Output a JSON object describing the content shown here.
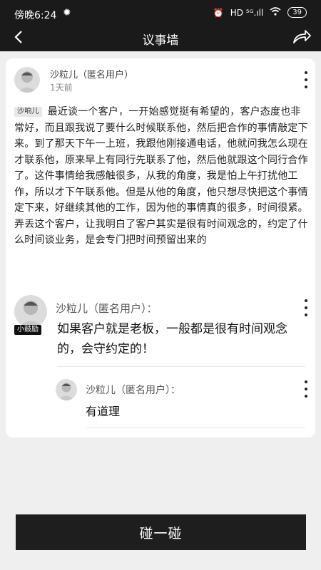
{
  "status_bar": {
    "time": "傍晚6:24",
    "network": "HD ⁵ᴳ.ıll",
    "battery": "39"
  },
  "nav": {
    "title": "议事墙"
  },
  "post": {
    "author": "沙粒儿（匿名用户）",
    "time_ago": "1天前",
    "tag": "沙响儿",
    "content": "最近谈一个客户，一开始感觉挺有希望的，客户态度也非常好，而且跟我说了要什么时候联系他，然后把合作的事情敲定下来。到了那天下午一上班，我跟他刚接通电话，他就问我怎么现在才联系他，原来早上有同行先联系了他，然后他就跟这个同行合作了。这件事情给我感触很多，从我的角度，我是怕上午打扰他工作，所以才下午联系他。但是从他的角度，他只想尽快把这个事情定下来，好继续其他的工作，因为他的事情真的很多，时间很紧。弄丢这个客户，让我明白了客户其实是很有时间观念的，约定了什么时间谈业务，是会专门把时间预留出来的"
  },
  "comments": [
    {
      "author": "沙粒儿（匿名用户）：",
      "badge": "小鼓励",
      "content": "如果客户就是老板，一般都是很有时间观念的，会守约定的！"
    },
    {
      "author": "沙粒儿（匿名用户）：",
      "content": "有道理"
    }
  ],
  "cta": {
    "label": "碰一碰"
  }
}
